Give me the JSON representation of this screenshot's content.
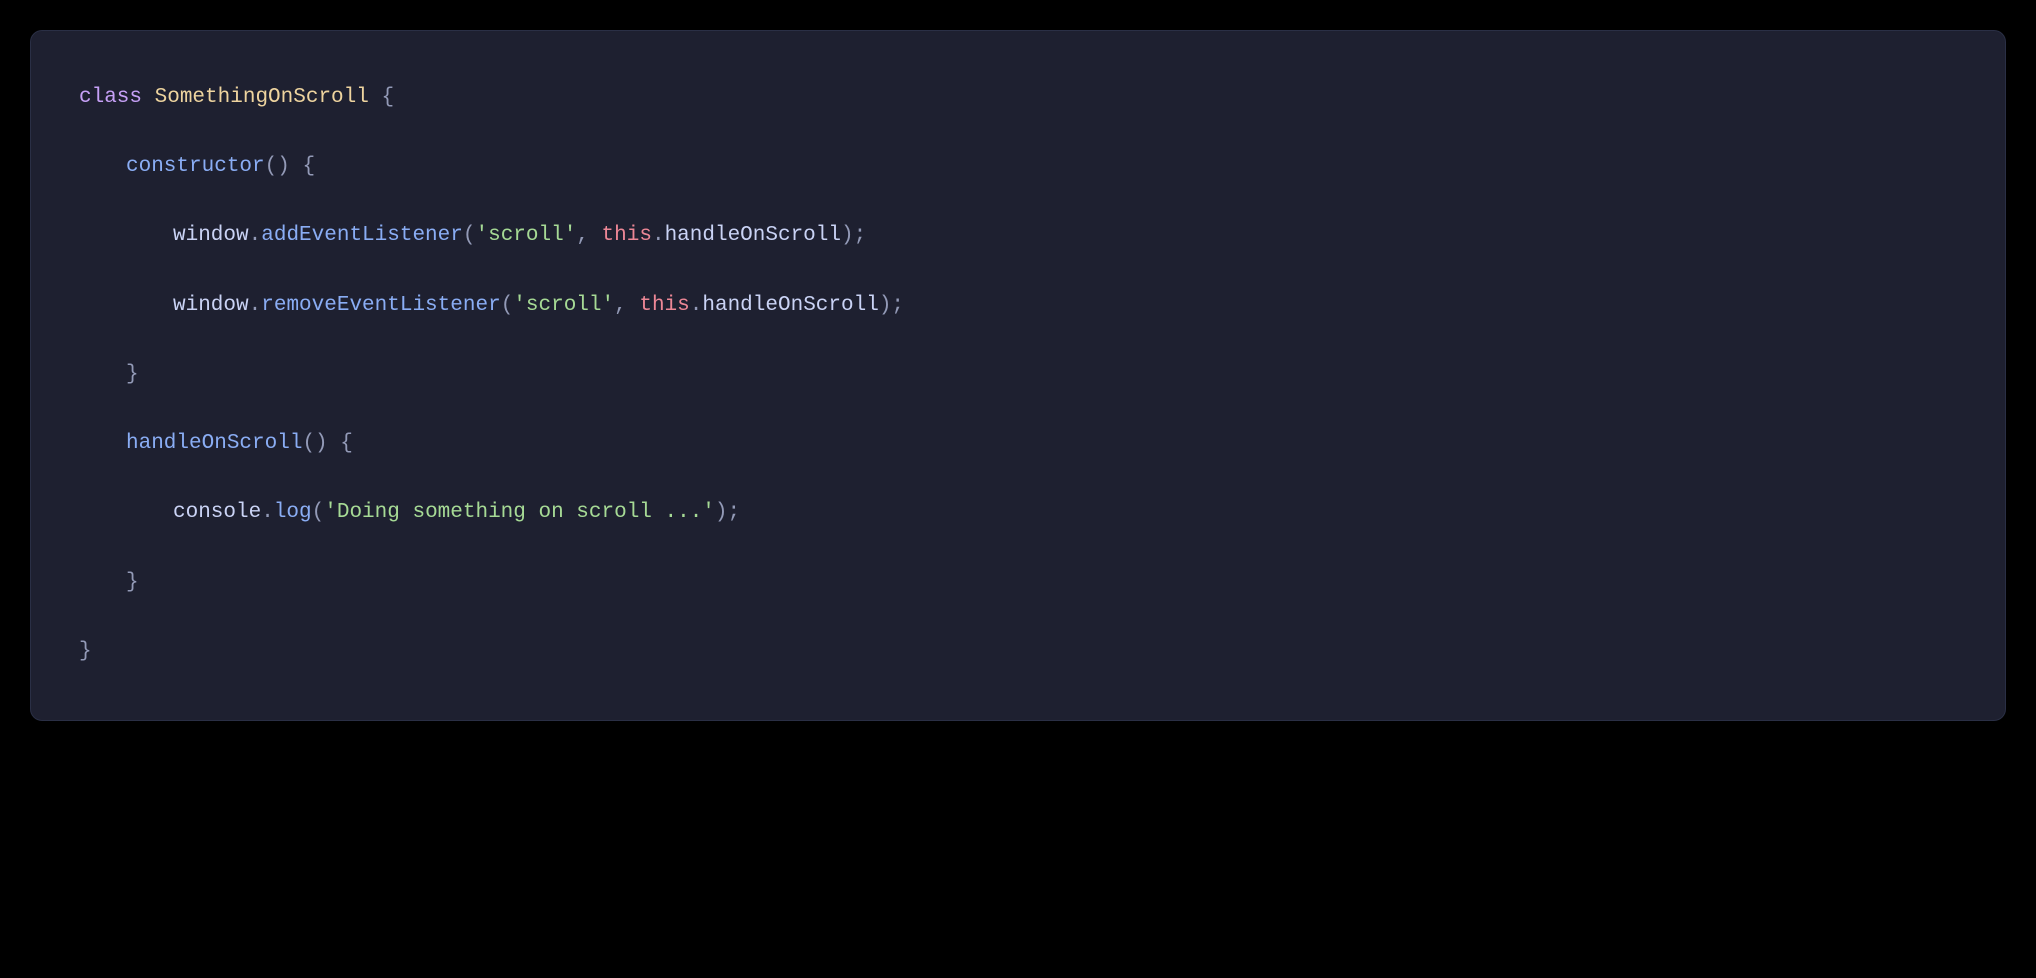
{
  "code": {
    "line1": {
      "keyword_class": "class",
      "class_name": "SomethingOnScroll",
      "brace_open": " {"
    },
    "line2": {
      "method_name": "constructor",
      "parens": "()",
      "brace_open": " {"
    },
    "line3": {
      "obj": "window",
      "dot1": ".",
      "call": "addEventListener",
      "paren_open": "(",
      "arg1": "'scroll'",
      "comma": ", ",
      "this_kw": "this",
      "dot2": ".",
      "prop": "handleOnScroll",
      "paren_close": ")",
      "semi": ";"
    },
    "line4": {
      "obj": "window",
      "dot1": ".",
      "call": "removeEventListener",
      "paren_open": "(",
      "arg1": "'scroll'",
      "comma": ", ",
      "this_kw": "this",
      "dot2": ".",
      "prop": "handleOnScroll",
      "paren_close": ")",
      "semi": ";"
    },
    "line5": {
      "brace_close": "}"
    },
    "line6": {
      "method_name": "handleOnScroll",
      "parens": "()",
      "brace_open": " {"
    },
    "line7": {
      "obj": "console",
      "dot1": ".",
      "call": "log",
      "paren_open": "(",
      "arg1": "'Doing something on scroll ...'",
      "paren_close": ")",
      "semi": ";"
    },
    "line8": {
      "brace_close": "}"
    },
    "line9": {
      "brace_close": "}"
    }
  },
  "colors": {
    "background": "#000000",
    "panel_bg": "#1e2030",
    "panel_border": "#2a2f45",
    "keyword": "#c6a0f6",
    "class_name": "#eed49f",
    "punctuation": "#939ab7",
    "method": "#8aadf4",
    "string": "#a6da95",
    "this": "#ed8796",
    "plain": "#cad3f5"
  }
}
